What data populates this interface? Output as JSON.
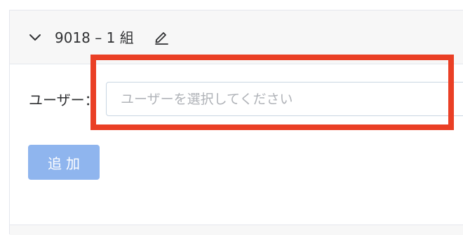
{
  "group": {
    "title": "9018 – 1 組",
    "expanded": true,
    "expand_icon": "chevron-down-icon",
    "edit_icon": "pencil-icon"
  },
  "user_field": {
    "label": "ユーザー：",
    "placeholder": "ユーザーを選択してください",
    "value": ""
  },
  "add_button": {
    "label": "追加",
    "color": "#8fb5ee"
  },
  "annotation": {
    "color": "#ea3f25"
  }
}
